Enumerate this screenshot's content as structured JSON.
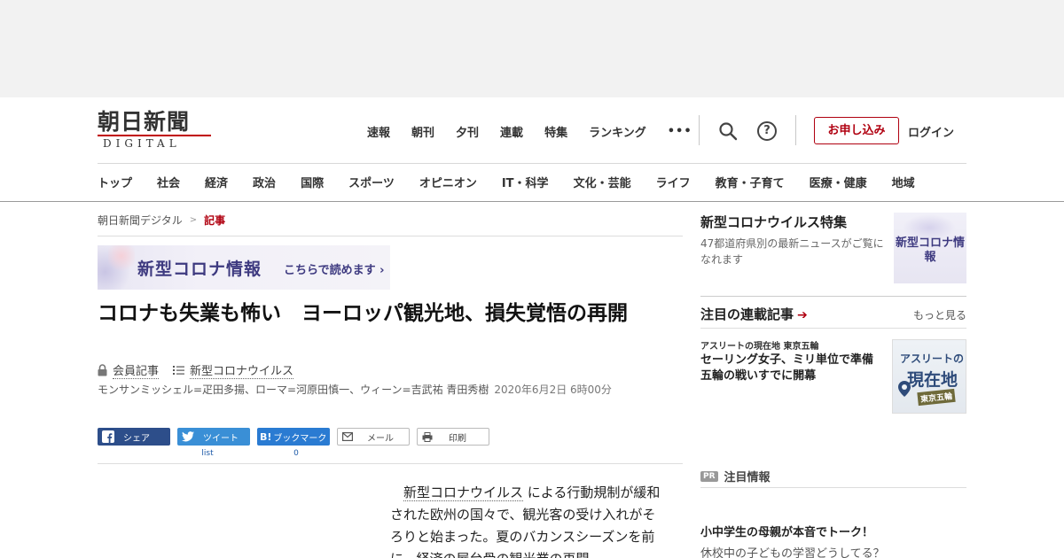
{
  "header": {
    "logo": {
      "jp": "朝日新聞",
      "en": "DIGITAL"
    },
    "top_nav": [
      "速報",
      "朝刊",
      "夕刊",
      "連載",
      "特集",
      "ランキング"
    ],
    "more_label": "•••",
    "help_label": "?",
    "apply_label": "お申し込み",
    "login_label": "ログイン",
    "categories": [
      "トップ",
      "社会",
      "経済",
      "政治",
      "国際",
      "スポーツ",
      "オピニオン",
      "IT・科学",
      "文化・芸能",
      "ライフ",
      "教育・子育て",
      "医療・健康",
      "地域"
    ]
  },
  "breadcrumb": {
    "home": "朝日新聞デジタル",
    "separator": ">",
    "current": "記事"
  },
  "corona_banner": {
    "title": "新型コロナ情報",
    "sub": "こちらで読めます ›"
  },
  "article": {
    "headline": "コロナも失業も怖い　ヨーロッパ観光地、損失覚悟の再開",
    "member_label": "会員記事",
    "topic_label": "新型コロナウイルス",
    "byline": "モンサンミッシェル=疋田多揚、ローマ=河原田慎一、ウィーン=吉武祐 青田秀樹",
    "date": "2020年6月2日 6時00分",
    "body_link": "新型コロナウイルス",
    "body_rest": "による行動規制が緩和された欧州の国々で、観光客の受け入れがそろりと始まった。夏のバカンスシーズンを前に、経済の屋台骨の観光業の再開"
  },
  "share": {
    "facebook": "シェア",
    "twitter": "ツイート",
    "twitter_count": "list",
    "hatena": "ブックマーク",
    "hatena_icon": "B!",
    "hatena_count": "0",
    "mail": "メール",
    "print": "印刷"
  },
  "sidebar": {
    "feature": {
      "title": "新型コロナウイルス特集",
      "desc": "47都道府県別の最新ニュースがご覧になれます",
      "thumb_text": "新型コロナ情報"
    },
    "series": {
      "title": "注目の連載記事",
      "arrow": "➔",
      "more": "もっと見る",
      "item": {
        "kicker": "アスリートの現在地 東京五輪",
        "title": "セーリング女子、ミリ単位で準備　五輪の戦いすでに開幕",
        "img_a": "アスリートの",
        "img_b": "現在地",
        "img_c": "東京五輪"
      }
    },
    "pr": {
      "badge": "PR",
      "title": "注目情報",
      "item_title": "小中学生の母親が本音でトーク！",
      "item_sub": "休校中の子どもの学習どうしてる？"
    }
  }
}
